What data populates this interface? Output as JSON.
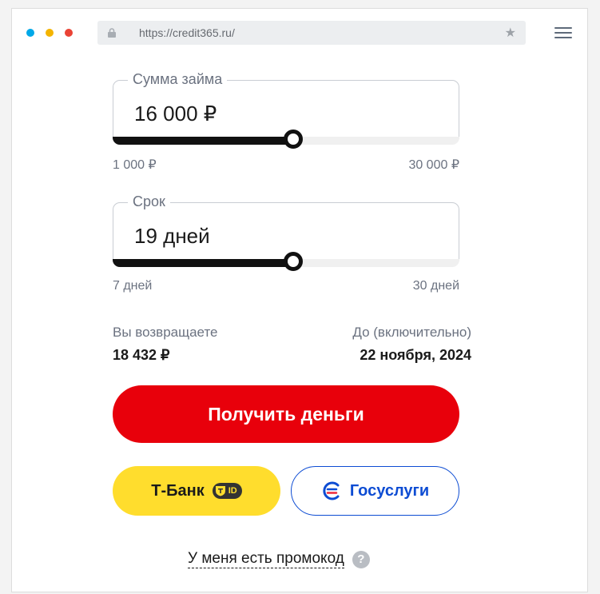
{
  "browser": {
    "url": "https://credit365.ru/",
    "dots": [
      {
        "name": "close-dot",
        "color": "#00a8e8"
      },
      {
        "name": "minimize-dot",
        "color": "#f4b400"
      },
      {
        "name": "maximize-dot",
        "color": "#ea4335"
      }
    ],
    "icons": {
      "lock": "lock-icon",
      "bookmark": "star-icon",
      "menu": "hamburger-menu-icon"
    }
  },
  "amount": {
    "label": "Сумма займа",
    "value": "16 000 ₽",
    "min_label": "1 000 ₽",
    "max_label": "30 000 ₽",
    "slider_fraction": 0.52
  },
  "term": {
    "label": "Срок",
    "value": "19 дней",
    "min_label": "7 дней",
    "max_label": "30 дней",
    "slider_fraction": 0.52
  },
  "summary": {
    "return_label": "Вы возвращаете",
    "return_value": "18 432 ₽",
    "due_label": "До (включительно)",
    "due_value": "22 ноября, 2024"
  },
  "buttons": {
    "get_money": "Получить деньги",
    "tbank": "Т-Банк",
    "tbank_badge": "ID",
    "gosuslugi": "Госуслуги"
  },
  "promo": {
    "text": "У меня есть промокод",
    "help_icon": "?"
  },
  "colors": {
    "primary": "#e8000b",
    "tbank": "#ffdd2d",
    "gosuslugi": "#0d4cd3"
  }
}
